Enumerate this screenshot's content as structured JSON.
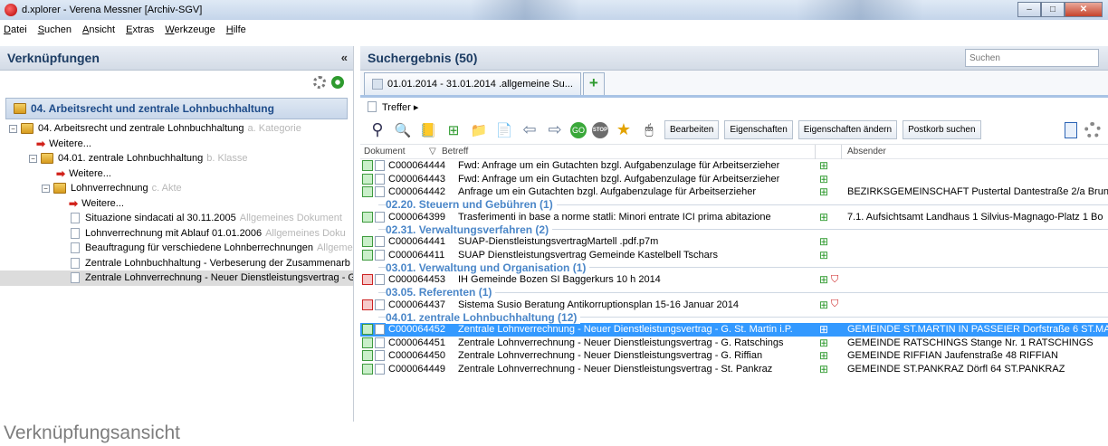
{
  "window": {
    "title": "d.xplorer - Verena Messner [Archiv-SGV]"
  },
  "menu": [
    "Datei",
    "Suchen",
    "Ansicht",
    "Extras",
    "Werkzeuge",
    "Hilfe"
  ],
  "left_panel": {
    "title": "Verknüpfungen",
    "collapse": "«",
    "breadcrumb": "04. Arbeitsrecht und zentrale Lohnbuchhaltung",
    "tree": [
      {
        "label": "04. Arbeitsrecht und zentrale Lohnbuchhaltung",
        "suffix": "a. Kategorie"
      },
      {
        "label": "Weitere..."
      },
      {
        "label": "04.01. zentrale Lohnbuchhaltung",
        "suffix": "b. Klasse"
      },
      {
        "label": "Weitere..."
      },
      {
        "label": "Lohnverrechnung",
        "suffix": "c. Akte"
      },
      {
        "label": "Weitere..."
      },
      {
        "label": "Situazione sindacati al 30.11.2005",
        "suffix": "Allgemeines Dokument"
      },
      {
        "label": "Lohnverrechnung mit Ablauf 01.01.2006",
        "suffix": "Allgemeines Doku"
      },
      {
        "label": "Beauftragung für verschiedene Lohnberrechnungen",
        "suffix": "Allgeme"
      },
      {
        "label": "Zentrale Lohnbuchhaltung - Verbeserung der Zusammenarb"
      },
      {
        "label": "Zentrale Lohnverrechnung - Neuer Dienstleistungsvertrag - G"
      }
    ]
  },
  "right_panel": {
    "title": "Suchergebnis (50)",
    "search_placeholder": "Suchen",
    "tab_label": "01.01.2014 - 31.01.2014 .allgemeine Su...",
    "plus": "+",
    "treffer": "Treffer ▸",
    "toolbar_buttons": [
      "Bearbeiten",
      "Eigenschaften",
      "Eigenschaften ändern",
      "Postkorb suchen"
    ],
    "columns": {
      "dokument": "Dokument",
      "betreff": "Betreff",
      "absender": "Absender"
    },
    "groups": [
      "02.20. Steuern und Gebühren (1)",
      "02.31. Verwaltungsverfahren (2)",
      "03.01. Verwaltung und Organisation (1)",
      "03.05. Referenten (1)",
      "04.01. zentrale Lohnbuchhaltung (12)"
    ],
    "rows": [
      {
        "id": "C000064444",
        "betreff": "Fwd: Anfrage um ein Gutachten bzgl. Aufgabenzulage für Arbeitserzieher",
        "absender": ""
      },
      {
        "id": "C000064443",
        "betreff": "Fwd: Anfrage um ein Gutachten bzgl. Aufgabenzulage für Arbeitserzieher",
        "absender": ""
      },
      {
        "id": "C000064442",
        "betreff": "Anfrage um ein Gutachten bzgl. Aufgabenzulage für Arbeitserzieher",
        "absender": "BEZIRKSGEMEINSCHAFT Pustertal Dantestraße 2/a Brun"
      },
      {
        "id": "C000064399",
        "betreff": "Trasferimenti in base a norme statli: Minori entrate ICI prima abitazione",
        "absender": "7.1. Aufsichtsamt Landhaus 1 Silvius-Magnago-Platz 1 Bo"
      },
      {
        "id": "C000064441",
        "betreff": "SUAP-DienstleistungsvertragMartell .pdf.p7m",
        "absender": ""
      },
      {
        "id": "C000064411",
        "betreff": "SUAP Dienstleistungsvertrag Gemeinde Kastelbell Tschars",
        "absender": ""
      },
      {
        "id": "C000064453",
        "betreff": "IH Gemeinde Bozen SI Baggerkurs 10 h 2014",
        "absender": ""
      },
      {
        "id": "C000064437",
        "betreff": "Sistema Susio Beratung Antikorruptionsplan 15-16 Januar 2014",
        "absender": ""
      },
      {
        "id": "C000064452",
        "betreff": "Zentrale Lohnverrechnung - Neuer Dienstleistungsvertrag - G. St. Martin i.P.",
        "absender": "GEMEINDE ST.MARTIN IN PASSEIER Dorfstraße 6 ST.MA"
      },
      {
        "id": "C000064451",
        "betreff": "Zentrale Lohnverrechnung - Neuer Dienstleistungsvertrag - G. Ratschings",
        "absender": "GEMEINDE RATSCHINGS Stange Nr. 1 RATSCHINGS"
      },
      {
        "id": "C000064450",
        "betreff": "Zentrale Lohnverrechnung - Neuer Dienstleistungsvertrag - G. Riffian",
        "absender": "GEMEINDE RIFFIAN Jaufenstraße 48 RIFFIAN"
      },
      {
        "id": "C000064449",
        "betreff": "Zentrale Lohnverrechnung - Neuer Dienstleistungsvertrag - St. Pankraz",
        "absender": "GEMEINDE ST.PANKRAZ Dörfl 64 ST.PANKRAZ"
      }
    ]
  },
  "caption": "Verknüpfungsansicht"
}
